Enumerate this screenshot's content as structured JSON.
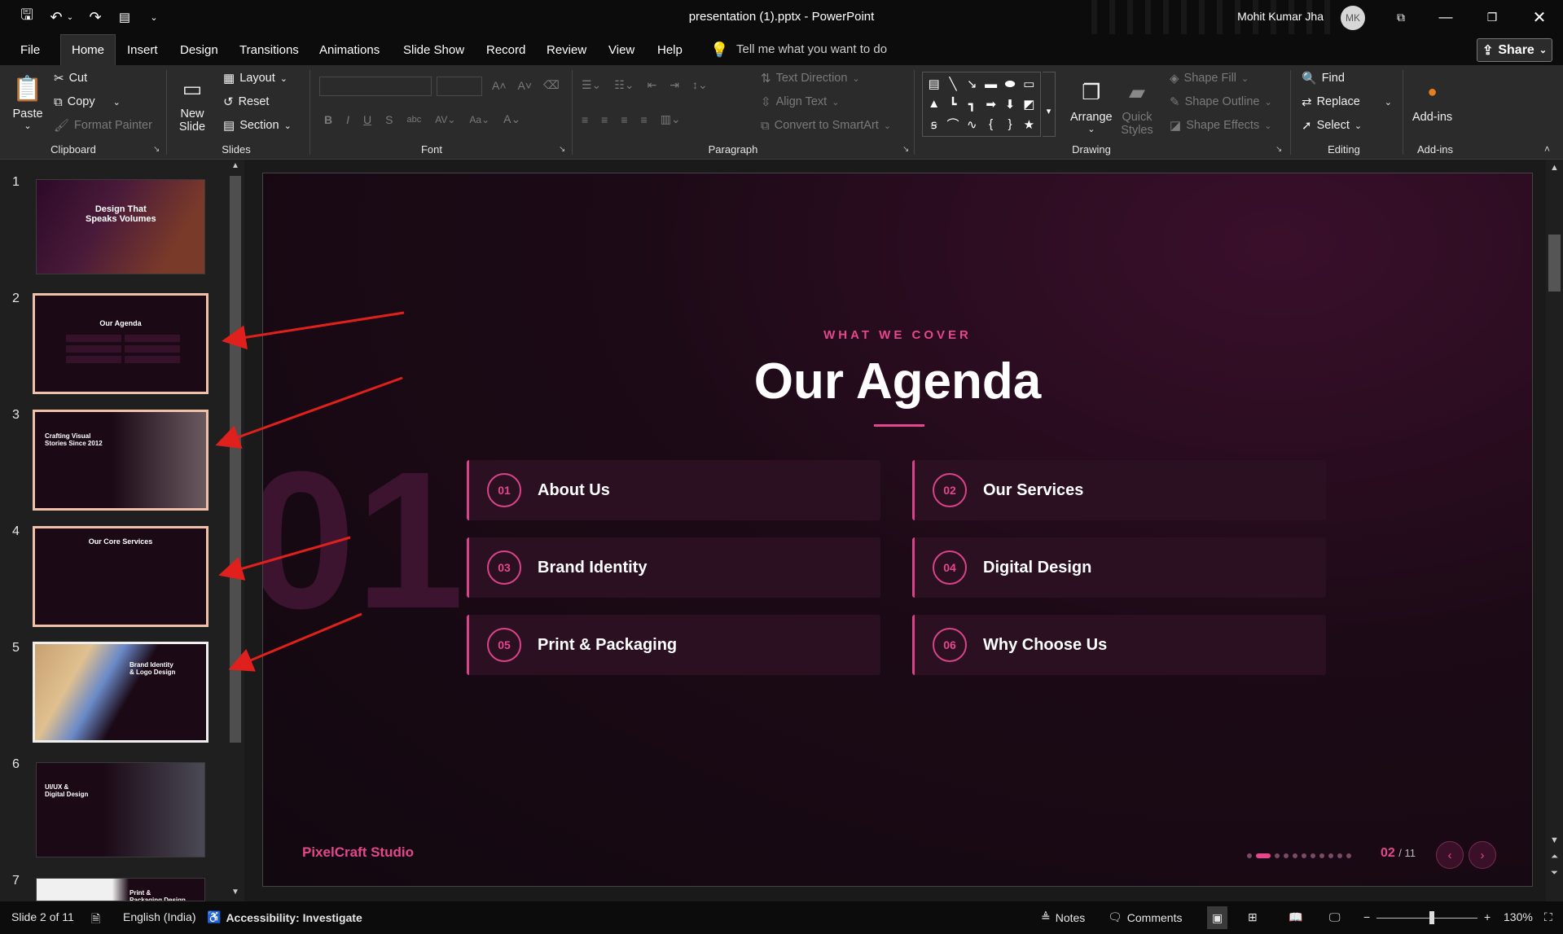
{
  "window": {
    "title": "presentation (1).pptx  -  PowerPoint",
    "user_name": "Mohit Kumar Jha",
    "user_initials": "MK"
  },
  "menu": {
    "tabs": [
      "File",
      "Home",
      "Insert",
      "Design",
      "Transitions",
      "Animations",
      "Slide Show",
      "Record",
      "Review",
      "View",
      "Help"
    ],
    "active_tab": "Home",
    "tell_me": "Tell me what you want to do",
    "share": "Share"
  },
  "ribbon": {
    "clipboard": {
      "paste": "Paste",
      "cut": "Cut",
      "copy": "Copy",
      "format_painter": "Format Painter",
      "label": "Clipboard"
    },
    "slides": {
      "new_slide_1": "New",
      "new_slide_2": "Slide",
      "layout": "Layout",
      "reset": "Reset",
      "section": "Section",
      "label": "Slides"
    },
    "font": {
      "label": "Font"
    },
    "paragraph": {
      "text_direction": "Text Direction",
      "align_text": "Align Text",
      "convert_smartart": "Convert to SmartArt",
      "label": "Paragraph"
    },
    "drawing": {
      "arrange": "Arrange",
      "quick_styles_1": "Quick",
      "quick_styles_2": "Styles",
      "shape_fill": "Shape Fill",
      "shape_outline": "Shape Outline",
      "shape_effects": "Shape Effects",
      "label": "Drawing"
    },
    "editing": {
      "find": "Find",
      "replace": "Replace",
      "select": "Select",
      "label": "Editing"
    },
    "addins": {
      "button": "Add-ins",
      "label": "Add-ins"
    }
  },
  "thumbnails": [
    {
      "num": "1",
      "title": "Design That\nSpeaks Volumes"
    },
    {
      "num": "2",
      "title": "Our Agenda"
    },
    {
      "num": "3",
      "title": "Crafting Visual\nStories Since 2012"
    },
    {
      "num": "4",
      "title": "Our Core Services"
    },
    {
      "num": "5",
      "title": "Brand Identity\n& Logo Design"
    },
    {
      "num": "6",
      "title": "UI/UX &\nDigital Design"
    },
    {
      "num": "7",
      "title": "Print &\nPackaging Design"
    }
  ],
  "slide": {
    "kicker": "WHAT WE COVER",
    "title": "Our Agenda",
    "bg_number": "01",
    "items": [
      {
        "num": "01",
        "label": "About Us"
      },
      {
        "num": "02",
        "label": "Our Services"
      },
      {
        "num": "03",
        "label": "Brand Identity"
      },
      {
        "num": "04",
        "label": "Digital Design"
      },
      {
        "num": "05",
        "label": "Print & Packaging"
      },
      {
        "num": "06",
        "label": "Why Choose Us"
      }
    ],
    "brand": "PixelCraft Studio",
    "page_current": "02",
    "page_total": "/ 11",
    "dots_total": 11,
    "dots_active": 2
  },
  "status": {
    "slide_info": "Slide 2 of 11",
    "language": "English (India)",
    "accessibility": "Accessibility: Investigate",
    "notes": "Notes",
    "comments": "Comments",
    "zoom": "130%"
  },
  "colors": {
    "accent": "#e4478c",
    "annotation_arrow": "#e0201c"
  }
}
